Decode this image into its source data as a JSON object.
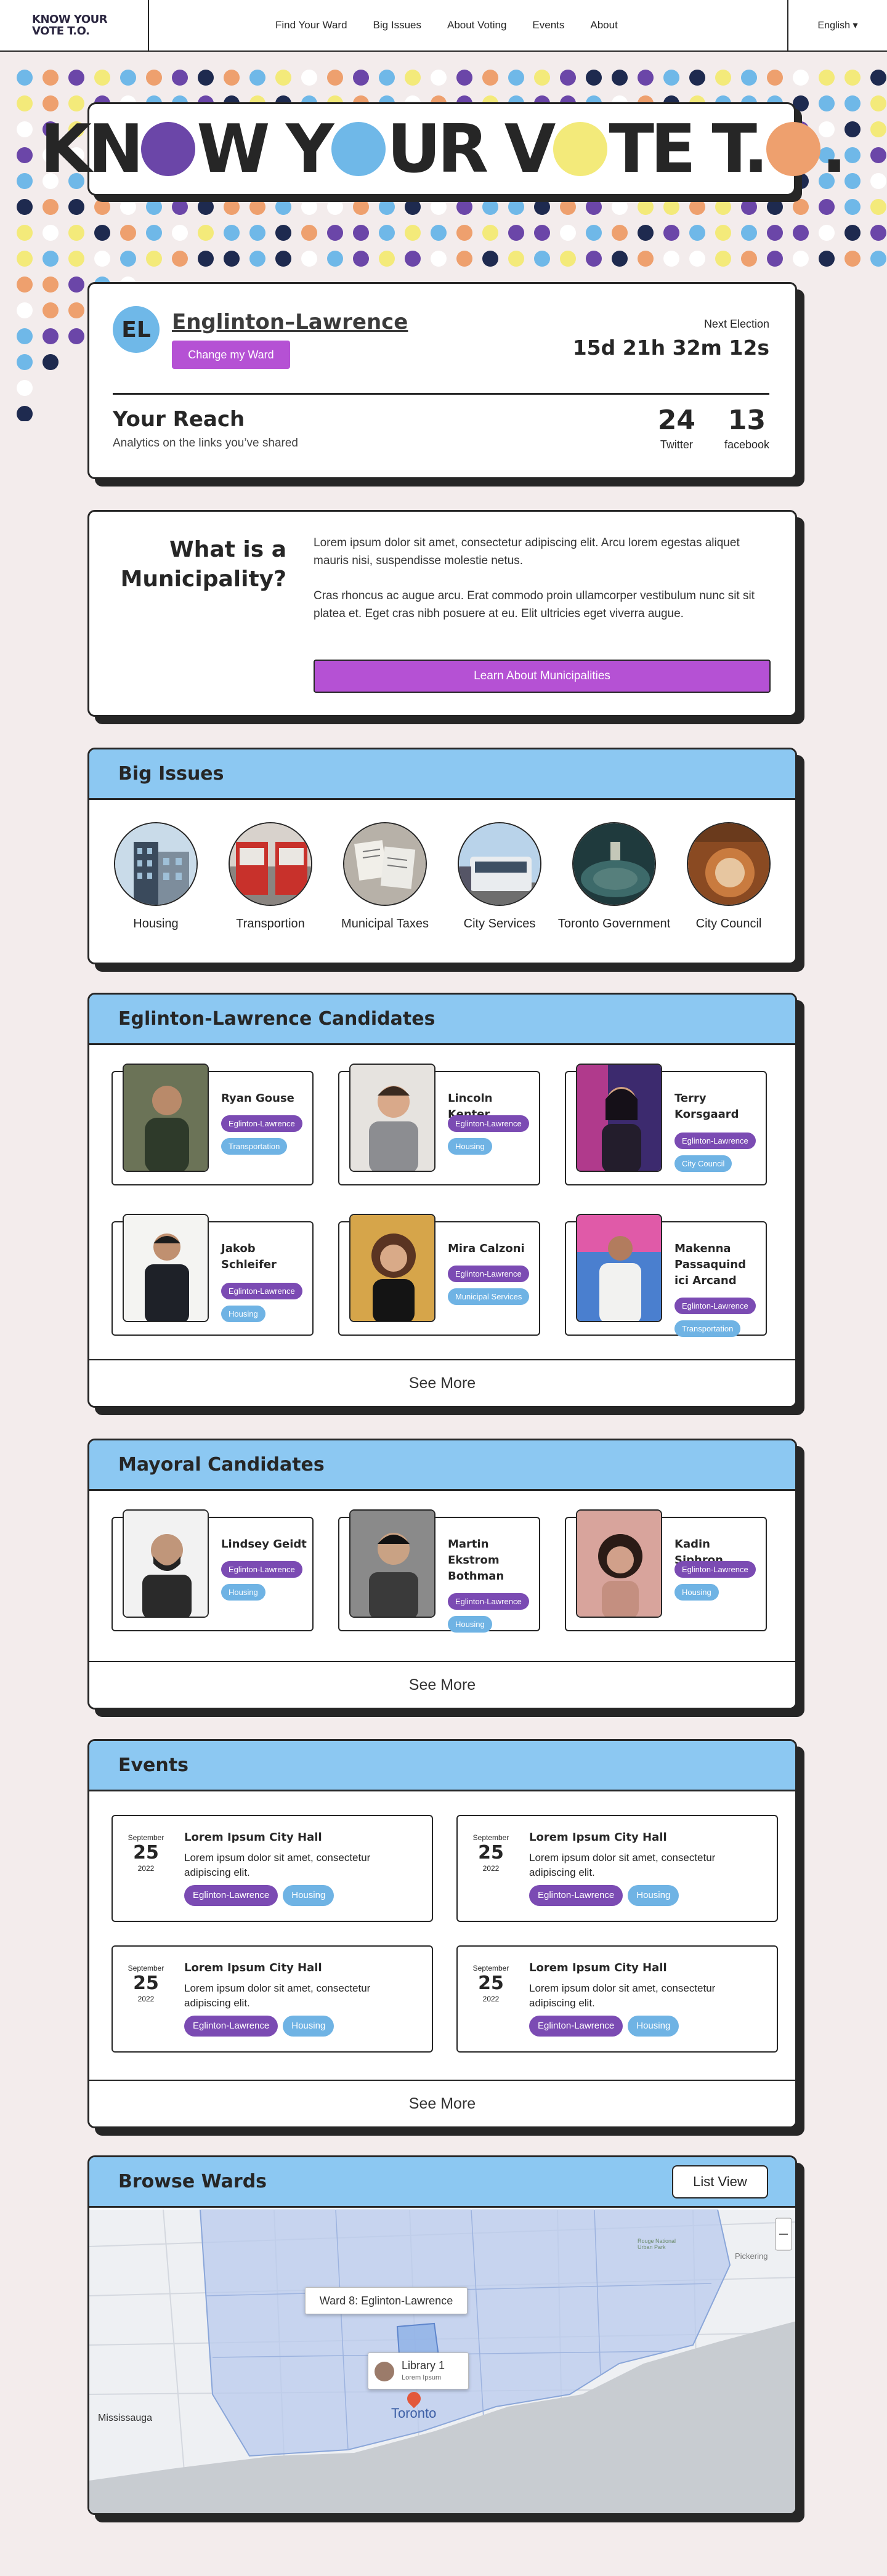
{
  "header": {
    "logo_line1": "KNOW YOUR",
    "logo_line2": "VOTE T.O.",
    "nav": [
      "Find Your Ward",
      "Big Issues",
      "About Voting",
      "Events",
      "About"
    ],
    "language": "English ▾"
  },
  "banner": {
    "part1": "KN",
    "part2": "W Y",
    "part3": "UR V",
    "part4": "TE T.",
    "part5": "."
  },
  "ward": {
    "initials": "EL",
    "name": "Englinton–Lawrence",
    "change_button": "Change my Ward",
    "next_label": "Next Election",
    "countdown": "15d 21h 32m 12s",
    "reach_title": "Your Reach",
    "reach_sub": "Analytics on the links you’ve shared",
    "twitter_count": "24",
    "twitter_label": "Twitter",
    "facebook_count": "13",
    "facebook_label": "facebook"
  },
  "municipality": {
    "question": "What is a Municipality?",
    "para1": "Lorem ipsum dolor sit amet, consectetur adipiscing elit. Arcu lorem egestas aliquet mauris nisi, suspendisse molestie netus.",
    "para2": "Cras rhoncus ac augue arcu. Erat commodo proin ullamcorper vestibulum nunc sit sit platea et. Eget cras nibh posuere at eu. Elit ultricies eget viverra augue.",
    "button": "Learn About Municipalities"
  },
  "big_issues": {
    "title": "Big Issues",
    "items": [
      {
        "label": "Housing",
        "icon": "housing-photo"
      },
      {
        "label": "Transportion",
        "icon": "transit-photo"
      },
      {
        "label": "Municipal Taxes",
        "icon": "taxes-photo"
      },
      {
        "label": "City Services",
        "icon": "city-services-photo"
      },
      {
        "label": "Toronto Government",
        "icon": "council-chamber-photo"
      },
      {
        "label": "City Council",
        "icon": "city-council-photo"
      }
    ]
  },
  "ward_candidates": {
    "title": "Eglinton-Lawrence Candidates",
    "cards": [
      {
        "name": "Ryan Gouse",
        "tags": [
          "Eglinton-Lawrence",
          "Transportation"
        ]
      },
      {
        "name": "Lincoln Kenter",
        "tags": [
          "Eglinton-Lawrence",
          "Housing"
        ]
      },
      {
        "name": "Terry Korsgaard",
        "tags": [
          "Eglinton-Lawrence",
          "City Council"
        ]
      },
      {
        "name": "Jakob Schleifer",
        "tags": [
          "Eglinton-Lawrence",
          "Housing"
        ]
      },
      {
        "name": "Mira Calzoni",
        "tags": [
          "Eglinton-Lawrence",
          "Municipal Services"
        ]
      },
      {
        "name": "Makenna Passaquind ici Arcand",
        "tags": [
          "Eglinton-Lawrence",
          "Transportation"
        ]
      }
    ],
    "see_more": "See More"
  },
  "mayoral": {
    "title": "Mayoral Candidates",
    "cards": [
      {
        "name": "Lindsey Geidt",
        "tags": [
          "Eglinton-Lawrence",
          "Housing"
        ]
      },
      {
        "name": "Martin Ekstrom Bothman",
        "tags": [
          "Eglinton-Lawrence",
          "Housing"
        ]
      },
      {
        "name": "Kadin Siphron",
        "tags": [
          "Eglinton-Lawrence",
          "Housing"
        ]
      }
    ],
    "see_more": "See More"
  },
  "events": {
    "title": "Events",
    "items": [
      {
        "month": "September",
        "day": "25",
        "year": "2022",
        "title": "Lorem Ipsum City Hall",
        "desc": "Lorem ipsum dolor sit amet, consectetur adipiscing elit.",
        "tags": [
          "Eglinton-Lawrence",
          "Housing"
        ]
      },
      {
        "month": "September",
        "day": "25",
        "year": "2022",
        "title": "Lorem Ipsum City Hall",
        "desc": "Lorem ipsum dolor sit amet, consectetur adipiscing elit.",
        "tags": [
          "Eglinton-Lawrence",
          "Housing"
        ]
      },
      {
        "month": "September",
        "day": "25",
        "year": "2022",
        "title": "Lorem Ipsum City Hall",
        "desc": "Lorem ipsum dolor sit amet, consectetur adipiscing elit.",
        "tags": [
          "Eglinton-Lawrence",
          "Housing"
        ]
      },
      {
        "month": "September",
        "day": "25",
        "year": "2022",
        "title": "Lorem Ipsum City Hall",
        "desc": "Lorem ipsum dolor sit amet, consectetur adipiscing elit.",
        "tags": [
          "Eglinton-Lawrence",
          "Housing"
        ]
      }
    ],
    "see_more": "See More"
  },
  "browse": {
    "title": "Browse Wards",
    "list_view": "List View",
    "ward_popup": "Ward 8: Eglinton-Lawrence",
    "library_title": "Library 1",
    "library_sub": "Lorem Ipsum",
    "city_label": "Toronto",
    "west_label": "Mississauga",
    "east_label": "Pickering",
    "park_label": "Rouge National Urban Park"
  },
  "colors": {
    "purple": "#6b46a8",
    "blue": "#6fb8e8",
    "yellow": "#f3ea7a",
    "orange": "#eea06e",
    "accent_button": "#b551d4",
    "panel_head": "#8cc8f2"
  }
}
